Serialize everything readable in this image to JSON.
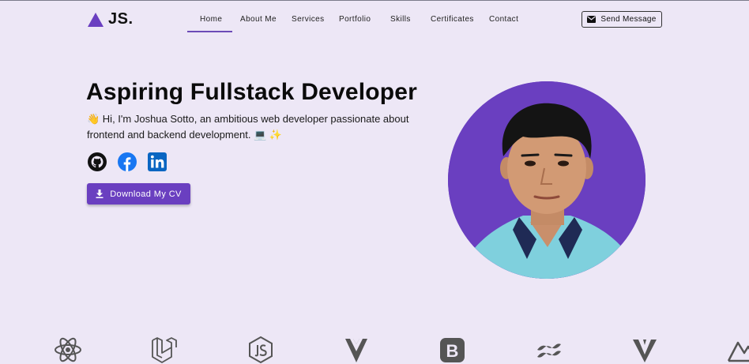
{
  "brand": {
    "name": "JS.",
    "accent": "#6a3fc0"
  },
  "nav": {
    "items": [
      {
        "label": "Home",
        "active": true
      },
      {
        "label": "About Me"
      },
      {
        "label": "Services"
      },
      {
        "label": "Portfolio"
      },
      {
        "label": "Skills"
      },
      {
        "label": "Certificates"
      },
      {
        "label": "Contact"
      }
    ],
    "cta_label": "Send Message",
    "cta_icon": "envelope-icon"
  },
  "hero": {
    "title": "Aspiring Fullstack Developer",
    "description": "👋 Hi, I'm Joshua Sotto, an ambitious web developer passionate about frontend and backend development. 💻 ✨",
    "socials": [
      "github-icon",
      "facebook-icon",
      "linkedin-icon"
    ],
    "cv_label": "Download My CV",
    "cv_icon": "download-icon"
  },
  "tech_icons": [
    "react-icon",
    "laravel-icon",
    "nodejs-icon",
    "vue-icon",
    "bootstrap-icon",
    "tailwind-icon",
    "vuetify-icon",
    "nuxt-icon"
  ]
}
